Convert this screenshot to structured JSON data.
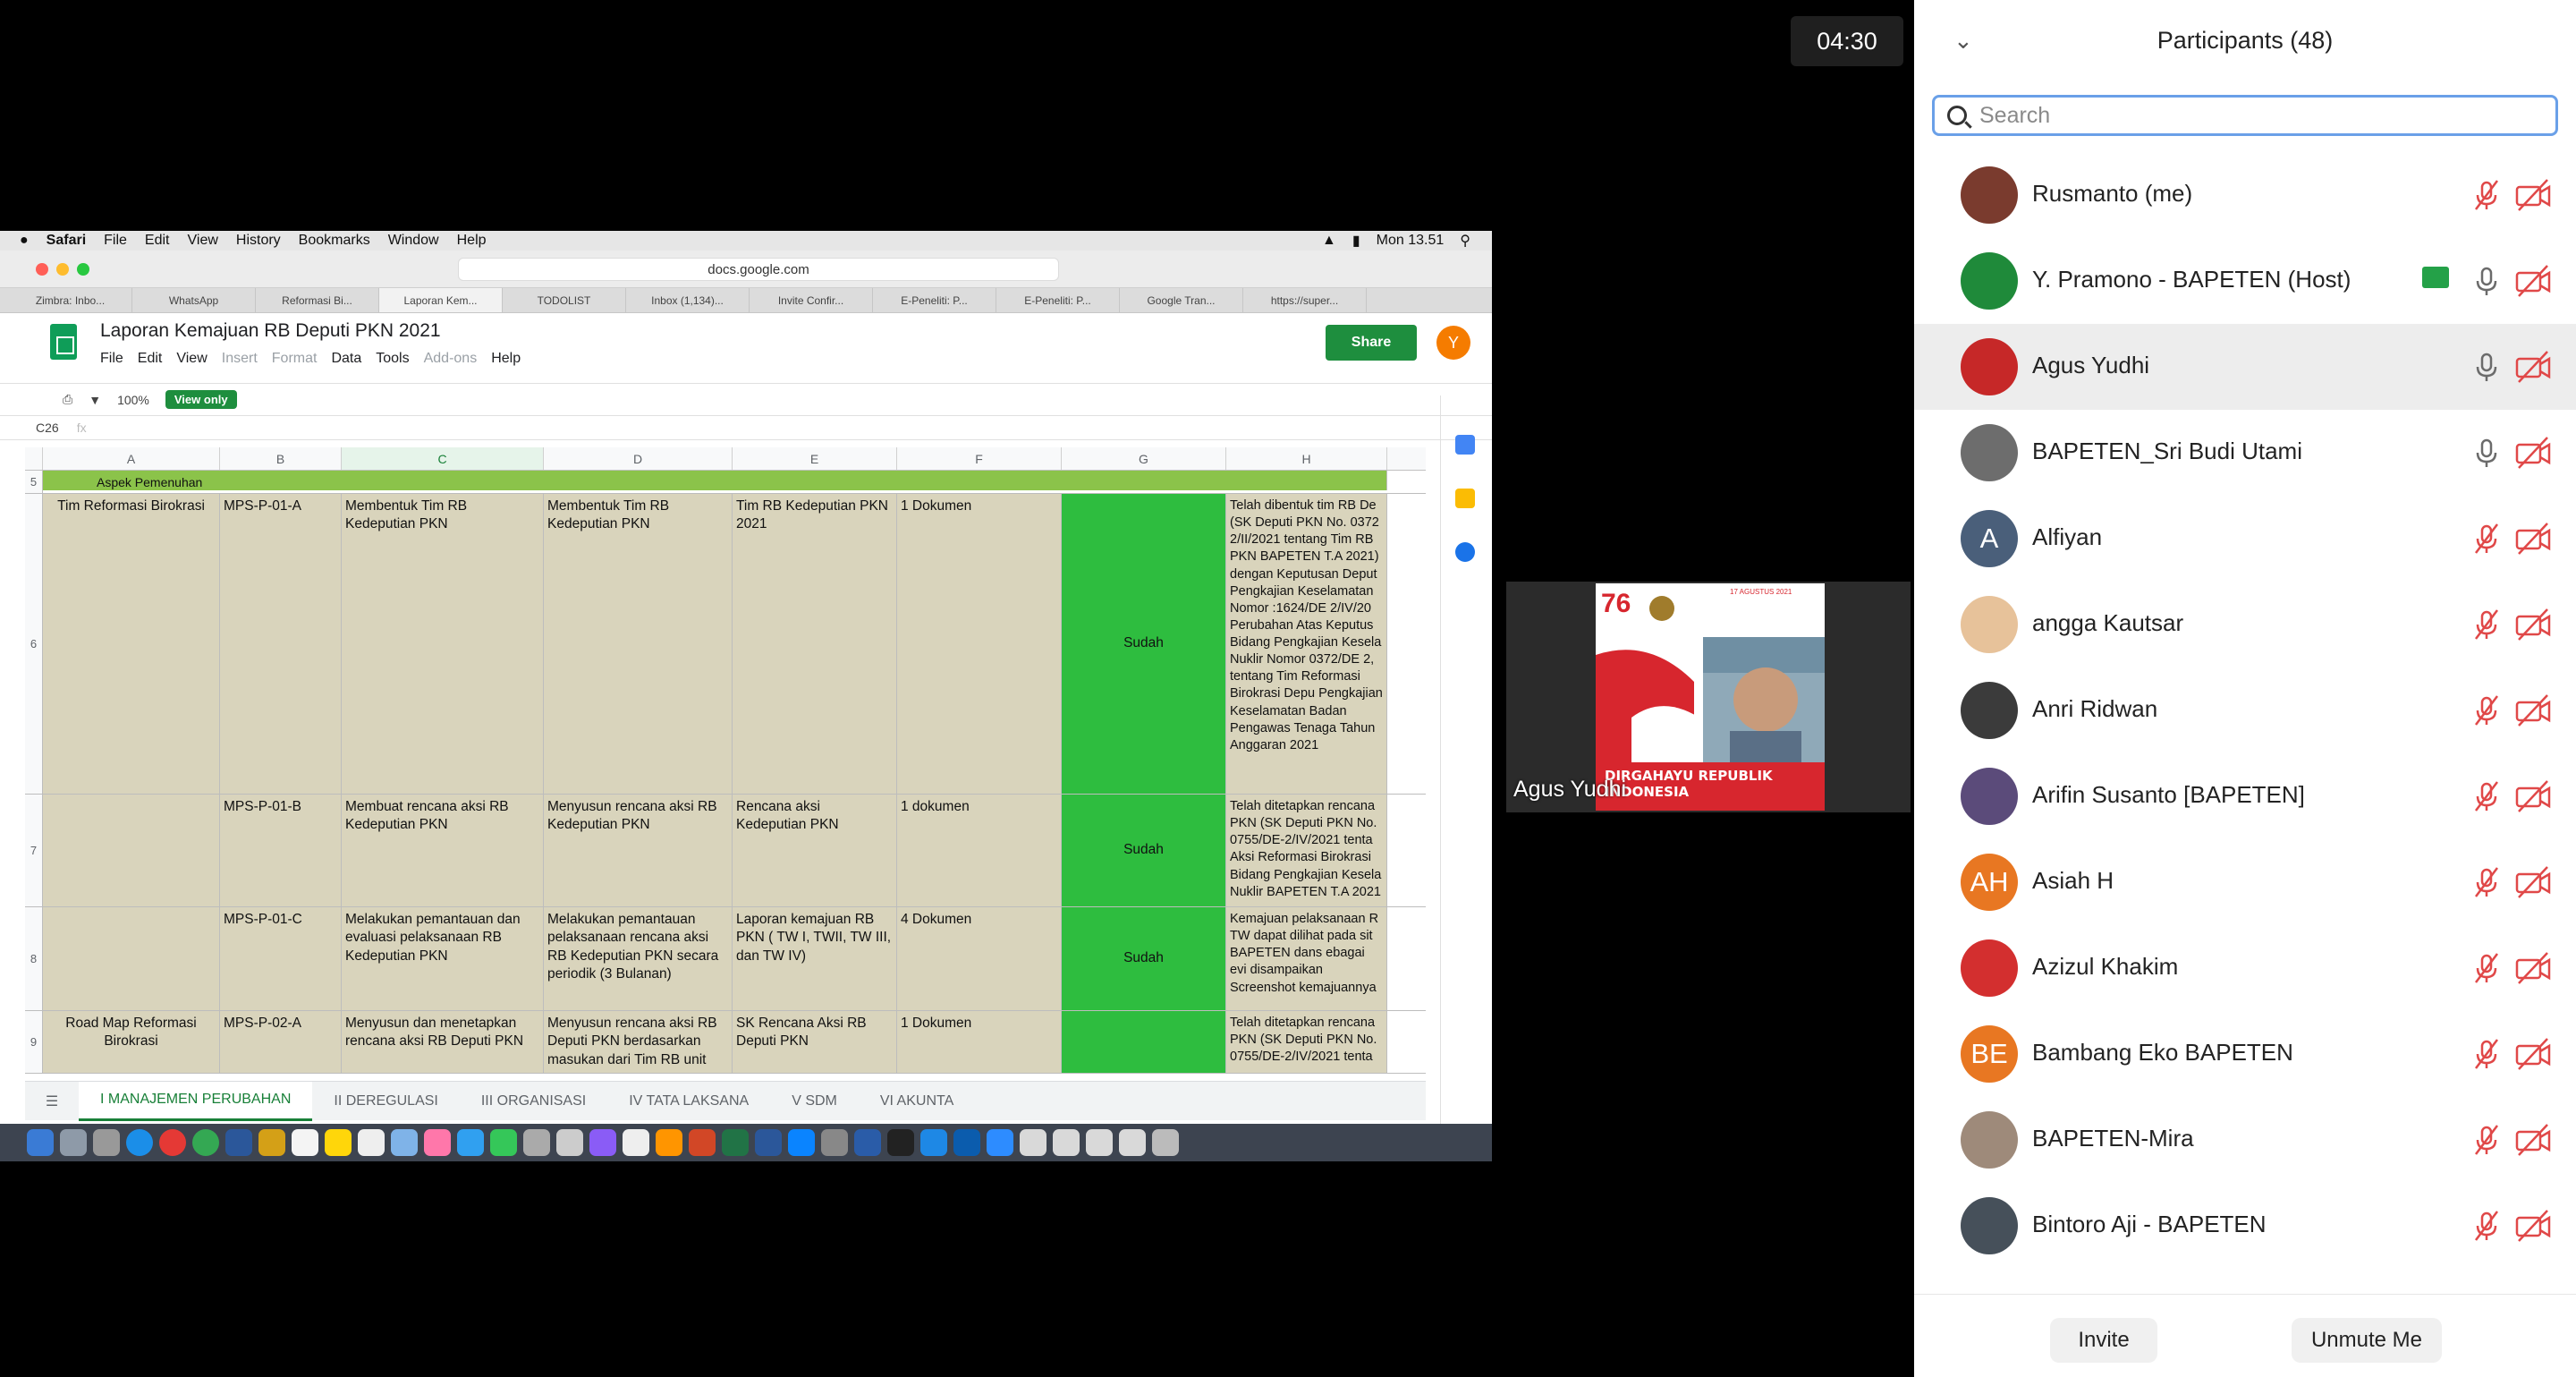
{
  "meeting": {
    "timer": "04:30"
  },
  "mac_menubar": {
    "app": "Safari",
    "items": [
      "File",
      "Edit",
      "View",
      "History",
      "Bookmarks",
      "Window",
      "Help"
    ],
    "clock": "Mon 13.51"
  },
  "safari": {
    "url": "docs.google.com",
    "tabs": [
      "Zimbra: Inbo...",
      "WhatsApp",
      "Reformasi Bi...",
      "Laporan Kem...",
      "TODOLIST",
      "Inbox (1,134)...",
      "Invite Confir...",
      "E-Peneliti: P...",
      "E-Peneliti: P...",
      "Google Tran...",
      "https://super..."
    ]
  },
  "sheet": {
    "title": "Laporan Kemajuan RB Deputi PKN 2021",
    "menu": [
      "File",
      "Edit",
      "View",
      "Insert",
      "Format",
      "Data",
      "Tools",
      "Add-ons",
      "Help"
    ],
    "menu_dim": [
      "Insert",
      "Format",
      "Add-ons"
    ],
    "share_label": "Share",
    "user_initial": "Y",
    "zoom": "100%",
    "view_only": "View only",
    "cell_ref": "C26",
    "columns": [
      "A",
      "B",
      "C",
      "D",
      "E",
      "F",
      "G",
      "H"
    ],
    "header_strip": "Aspek Pemenuhan",
    "rows": [
      {
        "num": "6",
        "a": "Tim Reformasi Birokrasi",
        "b": "MPS-P-01-A",
        "c": "Membentuk Tim RB Kedeputian PKN",
        "d": "Membentuk Tim RB Kedeputian PKN",
        "e": "Tim RB Kedeputian PKN 2021",
        "f": "1 Dokumen",
        "g": "Sudah",
        "h": "Telah dibentuk tim RB De (SK Deputi PKN No. 0372 2/II/2021 tentang Tim RB PKN BAPETEN T.A 2021) dengan Keputusan Deput Pengkajian Keselamatan Nomor :1624/DE 2/IV/20 Perubahan Atas Keputus Bidang Pengkajian Kesela Nuklir Nomor 0372/DE 2, tentang Tim Reformasi Birokrasi Depu Pengkajian Keselamatan Badan Pengawas Tenaga Tahun Anggaran 2021"
      },
      {
        "num": "7",
        "a": "",
        "b": "MPS-P-01-B",
        "c": "Membuat rencana aksi RB Kedeputian PKN",
        "d": "Menyusun rencana aksi RB Kedeputian PKN",
        "e": "Rencana aksi Kedeputian PKN",
        "f": "1 dokumen",
        "g": "Sudah",
        "h": "Telah ditetapkan rencana PKN (SK Deputi PKN No. 0755/DE-2/IV/2021 tenta Aksi Reformasi Birokrasi Bidang Pengkajian Kesela Nuklir BAPETEN T.A 2021"
      },
      {
        "num": "8",
        "a": "",
        "b": "MPS-P-01-C",
        "c": "Melakukan pemantauan dan evaluasi pelaksanaan RB Kedeputian PKN",
        "d": "Melakukan pemantauan pelaksanaan rencana aksi RB Kedeputian PKN secara periodik (3 Bulanan)",
        "e": "Laporan kemajuan RB PKN ( TW I, TWII, TW III, dan TW IV)",
        "f": "4 Dokumen",
        "g": "Sudah",
        "h": "Kemajuan pelaksanaan R TW dapat dilihat pada sit BAPETEN dans ebagai evi disampaikan Screenshot kemajuannya"
      },
      {
        "num": "9",
        "a": "Road Map Reformasi Birokrasi",
        "b": "MPS-P-02-A",
        "c": "Menyusun dan menetapkan rencana aksi RB Deputi PKN",
        "d": "Menyusun rencana aksi RB Deputi PKN berdasarkan masukan dari Tim RB unit",
        "e": "SK Rencana Aksi RB Deputi PKN",
        "f": "1 Dokumen",
        "g": "",
        "h": "Telah ditetapkan rencana PKN (SK Deputi PKN No. 0755/DE-2/IV/2021 tenta"
      }
    ],
    "sheet_tabs": [
      "I MANAJEMEN PERUBAHAN",
      "II DEREGULASI",
      "III ORGANISASI",
      "IV TATA LAKSANA",
      "V SDM",
      "VI AKUNTA"
    ]
  },
  "gallery": {
    "name": "Agus Yudhi",
    "banner_date": "17 AGUSTUS 2021",
    "banner_text": "DIRGAHAYU REPUBLIK INDONESIA",
    "banner_number": "76"
  },
  "participants": {
    "title": "Participants (48)",
    "search_placeholder": "Search",
    "list": [
      {
        "name": "Rusmanto (me)",
        "initials": "",
        "color": "#7a3b2e",
        "mic": "muted",
        "cam": "off"
      },
      {
        "name": "Y. Pramono - BAPETEN (Host)",
        "initials": "",
        "color": "#1f8a3a",
        "mic": "on",
        "cam": "off",
        "sharing": true
      },
      {
        "name": "Agus Yudhi",
        "initials": "",
        "color": "#c62828",
        "mic": "on",
        "cam": "off",
        "highlight": true
      },
      {
        "name": "BAPETEN_Sri Budi Utami",
        "initials": "",
        "color": "#6d6d6d",
        "mic": "on",
        "cam": "off"
      },
      {
        "name": "Alfiyan",
        "initials": "A",
        "color": "#4a5f7a",
        "mic": "muted",
        "cam": "off"
      },
      {
        "name": "angga Kautsar",
        "initials": "",
        "color": "#e7c29a",
        "mic": "muted",
        "cam": "off"
      },
      {
        "name": "Anri Ridwan",
        "initials": "",
        "color": "#3b3b3b",
        "mic": "muted",
        "cam": "off"
      },
      {
        "name": "Arifin Susanto [BAPETEN]",
        "initials": "",
        "color": "#5b4b7a",
        "mic": "muted",
        "cam": "off"
      },
      {
        "name": "Asiah H",
        "initials": "AH",
        "color": "#e87722",
        "mic": "muted",
        "cam": "off"
      },
      {
        "name": "Azizul Khakim",
        "initials": "",
        "color": "#d32f2f",
        "mic": "muted",
        "cam": "off"
      },
      {
        "name": "Bambang Eko BAPETEN",
        "initials": "BE",
        "color": "#e87722",
        "mic": "muted",
        "cam": "off"
      },
      {
        "name": "BAPETEN-Mira",
        "initials": "",
        "color": "#9e8a7a",
        "mic": "muted",
        "cam": "off"
      },
      {
        "name": "Bintoro Aji - BAPETEN",
        "initials": "",
        "color": "#46505a",
        "mic": "muted",
        "cam": "off"
      }
    ],
    "invite_label": "Invite",
    "unmute_label": "Unmute Me"
  },
  "colors": {
    "sheets_green": "#1e8e3e",
    "done_cell": "#2ebd3f",
    "tan_cell": "#d9d4bc",
    "muted_red": "#e04848",
    "search_border": "#6aa0e8"
  }
}
